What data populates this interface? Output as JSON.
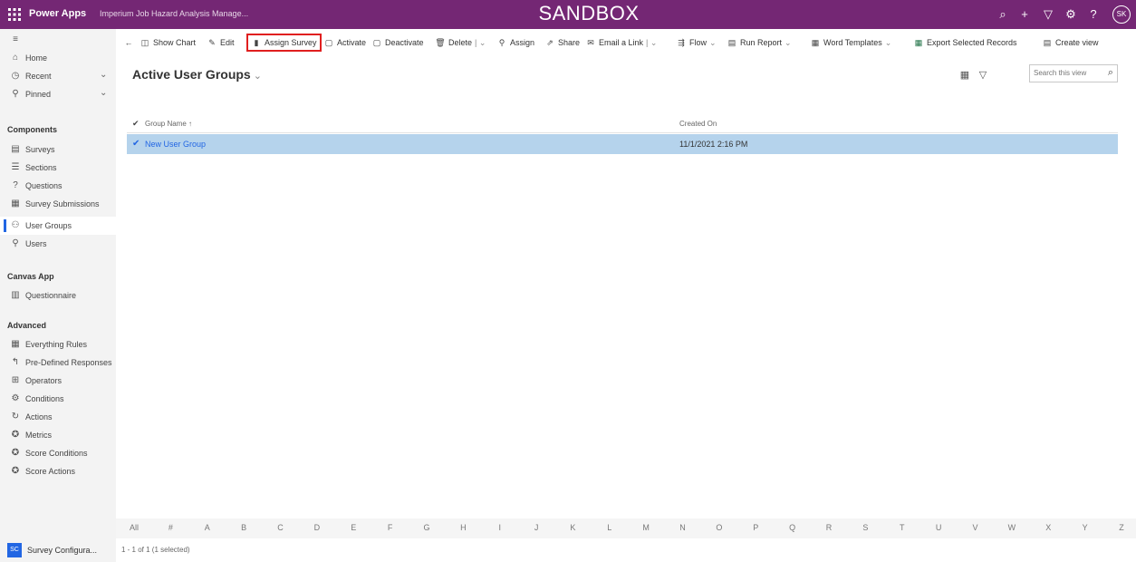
{
  "topbar": {
    "app_name": "Power Apps",
    "app_subtitle": "Imperium Job Hazard Analysis Manage...",
    "banner": "SANDBOX",
    "avatar_initials": "SK",
    "icons": [
      "search-icon",
      "add-icon",
      "filter-icon",
      "gear-icon",
      "help-icon"
    ]
  },
  "sidebar": {
    "top_items": [
      {
        "label": "Home",
        "icon": "home-icon"
      },
      {
        "label": "Recent",
        "icon": "clock-icon"
      },
      {
        "label": "Pinned",
        "icon": "pin-icon"
      }
    ],
    "components_header": "Components",
    "components": [
      {
        "label": "Surveys",
        "icon": "survey-icon"
      },
      {
        "label": "Sections",
        "icon": "sections-icon"
      },
      {
        "label": "Questions",
        "icon": "question-icon"
      },
      {
        "label": "Survey Submissions",
        "icon": "submissions-icon"
      },
      {
        "label": "User Groups",
        "icon": "user-groups-icon",
        "active": true
      },
      {
        "label": "Users",
        "icon": "user-icon"
      }
    ],
    "canvas_header": "Canvas App",
    "canvas": [
      {
        "label": "Questionnaire",
        "icon": "questionnaire-icon"
      }
    ],
    "advanced_header": "Advanced",
    "advanced": [
      {
        "label": "Everything Rules",
        "icon": "rules-icon"
      },
      {
        "label": "Pre-Defined Responses",
        "icon": "responses-icon"
      },
      {
        "label": "Operators",
        "icon": "operators-icon"
      },
      {
        "label": "Conditions",
        "icon": "conditions-icon"
      },
      {
        "label": "Actions",
        "icon": "actions-icon"
      },
      {
        "label": "Metrics",
        "icon": "metrics-icon"
      },
      {
        "label": "Score Conditions",
        "icon": "score-conditions-icon"
      },
      {
        "label": "Score Actions",
        "icon": "score-actions-icon"
      }
    ],
    "footer": {
      "badge": "SC",
      "label": "Survey Configura..."
    }
  },
  "commands": [
    {
      "label": "Show Chart",
      "icon": "chart-icon"
    },
    {
      "label": "Edit",
      "icon": "edit-icon"
    },
    {
      "label": "Assign Survey",
      "icon": "assign-survey-icon",
      "highlighted": true
    },
    {
      "label": "Activate",
      "icon": "activate-icon"
    },
    {
      "label": "Deactivate",
      "icon": "deactivate-icon"
    },
    {
      "label": "Delete",
      "icon": "delete-icon"
    },
    {
      "label": "Assign",
      "icon": "assign-icon"
    },
    {
      "label": "Share",
      "icon": "share-icon"
    },
    {
      "label": "Email a Link",
      "icon": "email-icon"
    },
    {
      "label": "Flow",
      "icon": "flow-icon"
    },
    {
      "label": "Run Report",
      "icon": "report-icon"
    },
    {
      "label": "Word Templates",
      "icon": "word-icon"
    },
    {
      "label": "Export Selected Records",
      "icon": "excel-icon"
    },
    {
      "label": "Create view",
      "icon": "view-icon"
    }
  ],
  "view": {
    "title": "Active User Groups",
    "search_placeholder": "Search this view"
  },
  "grid": {
    "columns": [
      "Group Name ↑",
      "Created On"
    ],
    "rows": [
      {
        "name": "New User Group",
        "created_on": "11/1/2021 2:16 PM",
        "selected": true
      }
    ]
  },
  "jumpbar": [
    "All",
    "#",
    "A",
    "B",
    "C",
    "D",
    "E",
    "F",
    "G",
    "H",
    "I",
    "J",
    "K",
    "L",
    "M",
    "N",
    "O",
    "P",
    "Q",
    "R",
    "S",
    "T",
    "U",
    "V",
    "W",
    "X",
    "Y",
    "Z"
  ],
  "status": "1 - 1 of 1 (1 selected)"
}
